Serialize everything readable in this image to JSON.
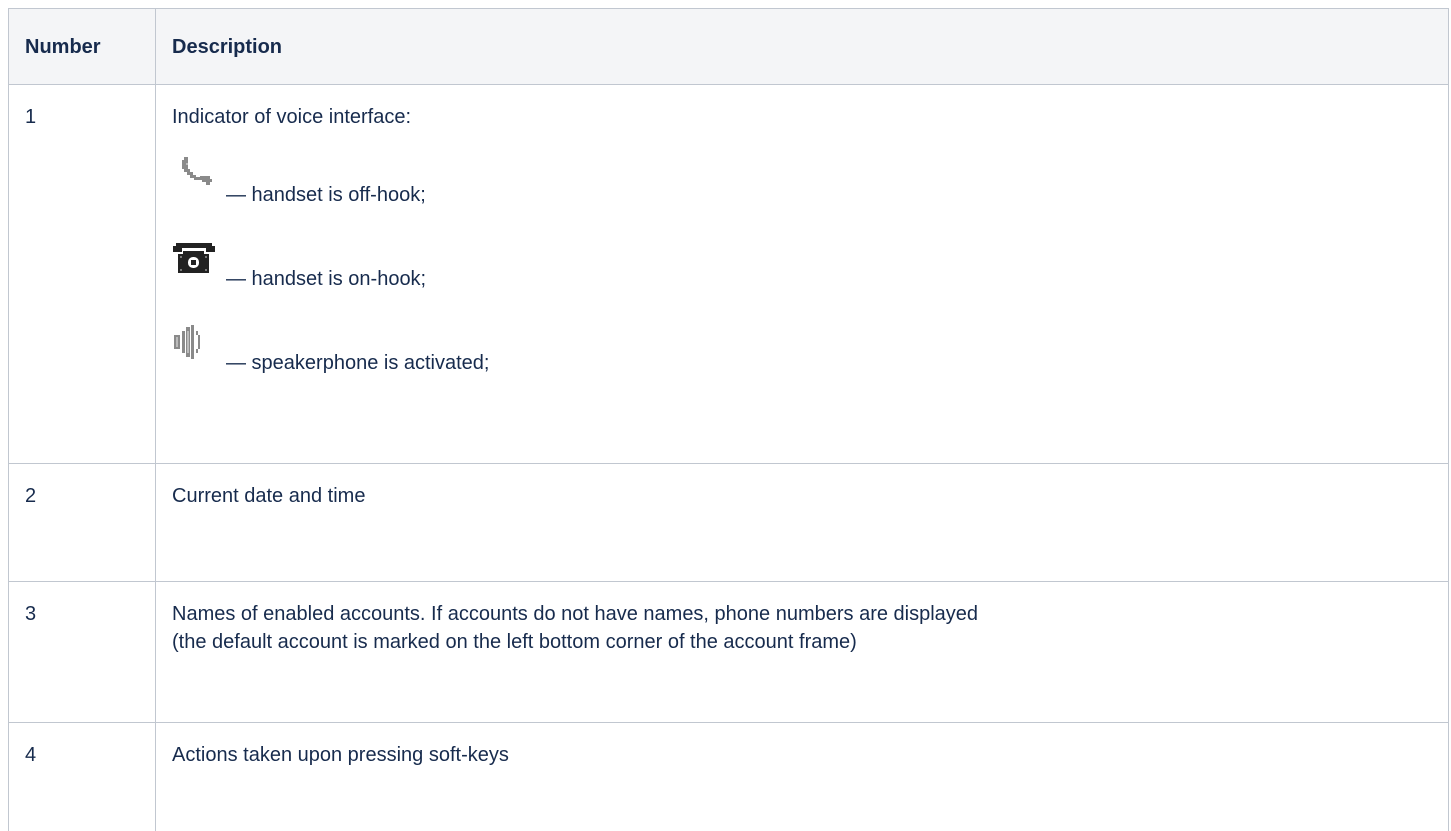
{
  "table": {
    "headers": {
      "number": "Number",
      "description": "Description"
    },
    "rows": [
      {
        "number": "1",
        "description": "Indicator of voice interface:",
        "indicators": [
          {
            "icon": "handset-off-hook-icon",
            "text": "— handset is off-hook;"
          },
          {
            "icon": "handset-on-hook-icon",
            "text": "— handset is on-hook;"
          },
          {
            "icon": "speakerphone-icon",
            "text": "— speakerphone is activated;"
          }
        ]
      },
      {
        "number": "2",
        "description": "Current date and time"
      },
      {
        "number": "3",
        "description_line1": "Names of enabled accounts. If accounts do not have names, phone numbers are displayed",
        "description_line2": "(the default account is marked on the left bottom corner of the account frame)"
      },
      {
        "number": "4",
        "description": "Actions taken upon pressing soft-keys"
      }
    ]
  },
  "colors": {
    "border": "#c1c7d0",
    "header_background": "#f4f5f7",
    "text": "#172b4d",
    "icon_grey": "#8a8a8a",
    "icon_dark": "#222222"
  }
}
